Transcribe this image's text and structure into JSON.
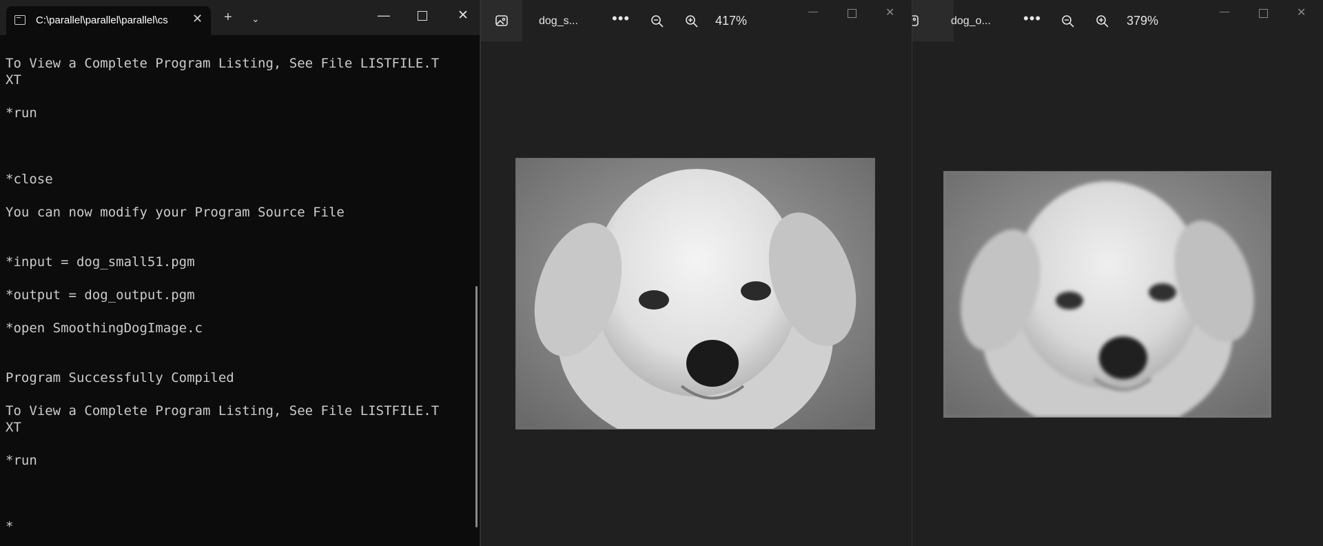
{
  "terminal": {
    "tab_title": "C:\\parallel\\parallel\\parallel\\cs",
    "lines": [
      "To View a Complete Program Listing, See File LISTFILE.T",
      "XT",
      "",
      "*run",
      "",
      "",
      "",
      "*close",
      "",
      "You can now modify your Program Source File",
      "",
      "",
      "*input = dog_small51.pgm",
      "",
      "*output = dog_output.pgm",
      "",
      "*open SmoothingDogImage.c",
      "",
      "",
      "Program Successfully Compiled",
      "",
      "To View a Complete Program Listing, See File LISTFILE.T",
      "XT",
      "",
      "*run",
      "",
      "",
      "",
      "*"
    ]
  },
  "viewer1": {
    "title": "dog_s...",
    "zoom": "417%",
    "image_name": "dog-small-image"
  },
  "viewer2": {
    "title": "dog_o...",
    "zoom": "379%",
    "image_name": "dog-output-image"
  },
  "colors": {
    "terminal_bg": "#0c0c0c",
    "viewer_bg": "#202020",
    "text": "#cccccc"
  }
}
